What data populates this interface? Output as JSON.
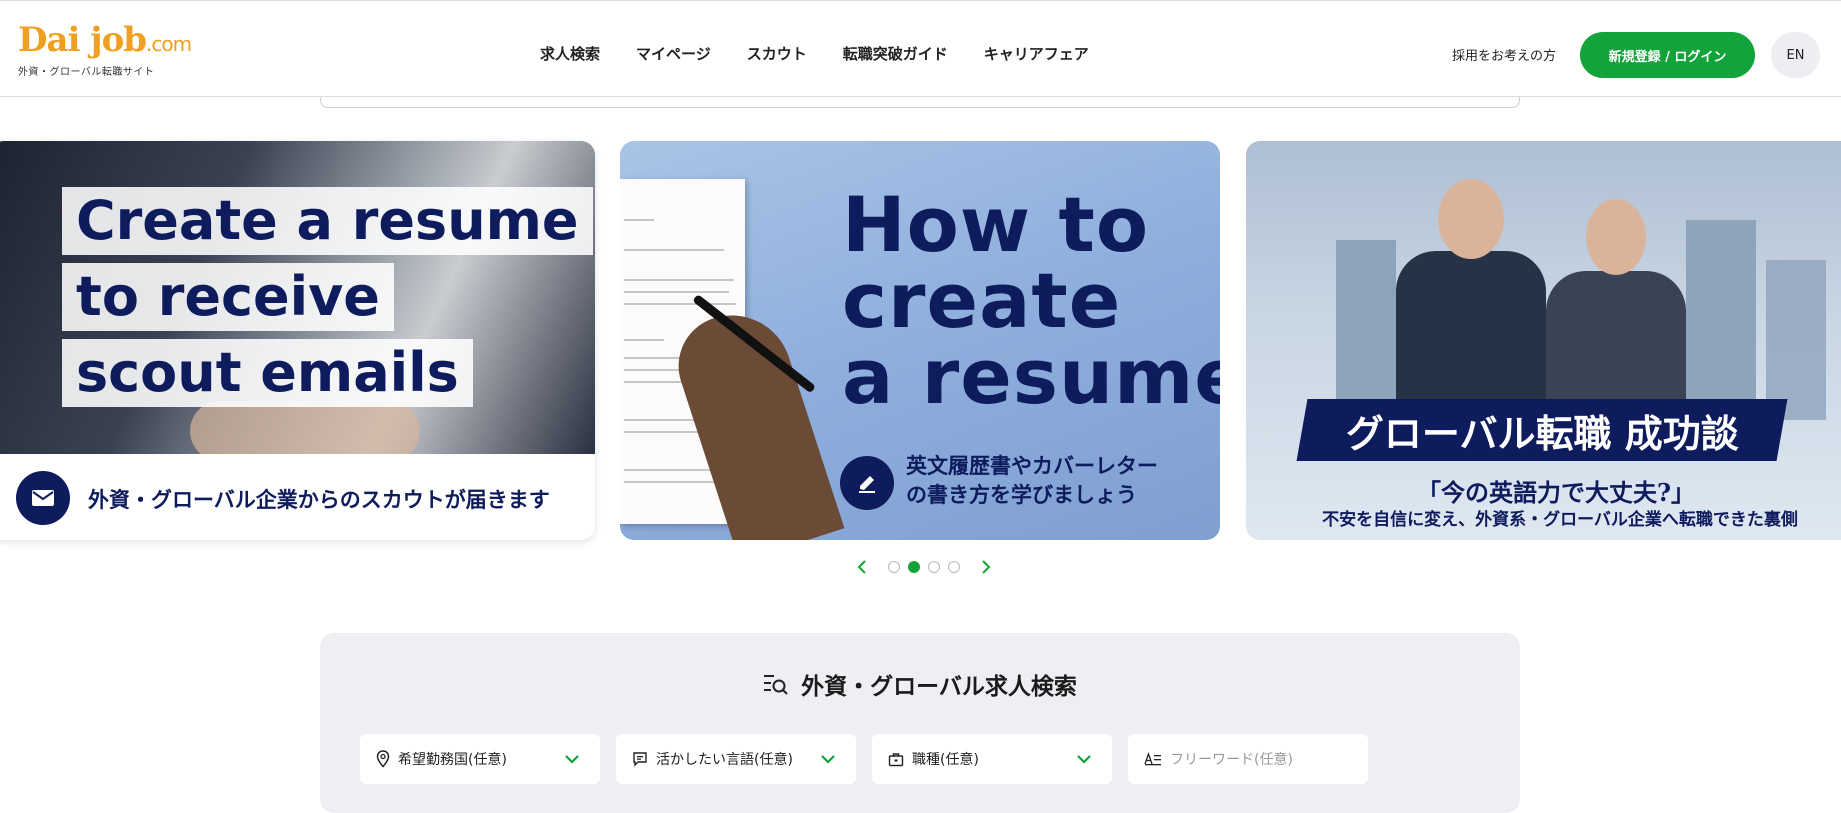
{
  "header": {
    "logo_text": "Dai job",
    "logo_suffix": ".com",
    "logo_tagline": "外資・グローバル転職サイト",
    "nav": [
      "求人検索",
      "マイページ",
      "スカウト",
      "転職突破ガイド",
      "キャリアフェア"
    ],
    "recruiter_link": "採用をお考えの方",
    "login_button": "新規登録 / ログイン",
    "language_button": "EN"
  },
  "carousel": {
    "slides": [
      {
        "headline_lines": [
          "Create a resume",
          "to receive",
          "scout emails"
        ],
        "caption": "外資・グローバル企業からのスカウトが届きます",
        "icon": "mail-icon"
      },
      {
        "headline_lines": [
          "How to",
          "create",
          "a resume"
        ],
        "caption_lines": [
          "英文履歴書やカバーレター",
          "の書き方を学びましょう"
        ],
        "icon": "pencil-icon"
      },
      {
        "banner": "グローバル転職 成功談",
        "quote": "「今の英語力で大丈夫?」",
        "subline": "不安を自信に変え、外資系・グローバル企業へ転職できた裏側"
      }
    ],
    "dot_count": 4,
    "active_dot": 2
  },
  "search": {
    "title": "外資・グローバル求人検索",
    "fields": [
      {
        "icon": "location-pin-icon",
        "label": "希望勤務国(任意)",
        "type": "select"
      },
      {
        "icon": "speech-bubble-icon",
        "label": "活かしたい言語(任意)",
        "type": "select"
      },
      {
        "icon": "briefcase-icon",
        "label": "職種(任意)",
        "type": "select"
      },
      {
        "icon": "text-input-icon",
        "placeholder": "フリーワード(任意)",
        "type": "text"
      }
    ]
  },
  "colors": {
    "brand_green": "#12a33a",
    "brand_navy": "#0e1b5c",
    "logo_orange": "#f0a020"
  }
}
